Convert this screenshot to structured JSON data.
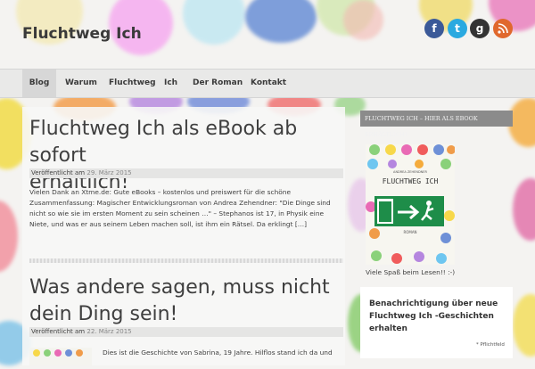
{
  "site": {
    "title": "Fluchtweg Ich"
  },
  "social_icons": [
    {
      "name": "facebook-icon",
      "glyph": "f",
      "color": "#3b5998"
    },
    {
      "name": "twitter-icon",
      "glyph": "t",
      "color": "#2aa9e0"
    },
    {
      "name": "google-plus-icon",
      "glyph": "g",
      "color": "#333333"
    },
    {
      "name": "rss-icon",
      "glyph": "r",
      "color": "#e0682d"
    }
  ],
  "nav": {
    "items": [
      "Blog",
      "Warum",
      "Fluchtweg",
      "Ich",
      "Der Roman",
      "Kontakt"
    ],
    "active": "Blog"
  },
  "posts": [
    {
      "title_line1": "Fluchtweg Ich als eBook ab sofort",
      "title_line2": "erhältlich!",
      "meta_label": "Veröffentlicht am",
      "date": "29. März 2015",
      "excerpt": "Vielen Dank an Xtme.de: Gute eBooks – kostenlos und preiswert für die schöne Zusammenfassung: Magischer Entwicklungsroman von Andrea Zehendner: \"Die Dinge sind nicht so wie sie im ersten Moment zu sein scheinen …\" – Stephanos ist 17, in Physik eine Niete, und was er aus seinem Leben machen soll, ist ihm ein Rätsel. Da erklingt […]"
    },
    {
      "title_line1": "Was andere sagen, muss nicht",
      "title_line2": "dein Ding sein!",
      "meta_label": "Veröffentlicht am",
      "date": "22. März 2015",
      "excerpt": "Dies ist die Geschichte von Sabrina, 19 Jahre. Hilflos stand ich da und"
    }
  ],
  "sidebar": {
    "widget_title": "FLUCHTWEG ICH – HIER ALS EBOOK ERHÄLTLICH!",
    "book_author": "ANDREA ZEHENDNER",
    "book_title": "FLUCHTWEG ICH",
    "book_genre": "ROMAN",
    "caption": "Viele Spaß beim Lesen!! :-)",
    "subscribe_title": "Benachrichtigung über neue Fluchtweg Ich -Geschichten erhalten",
    "required_note": "* Pflichtfeld"
  }
}
